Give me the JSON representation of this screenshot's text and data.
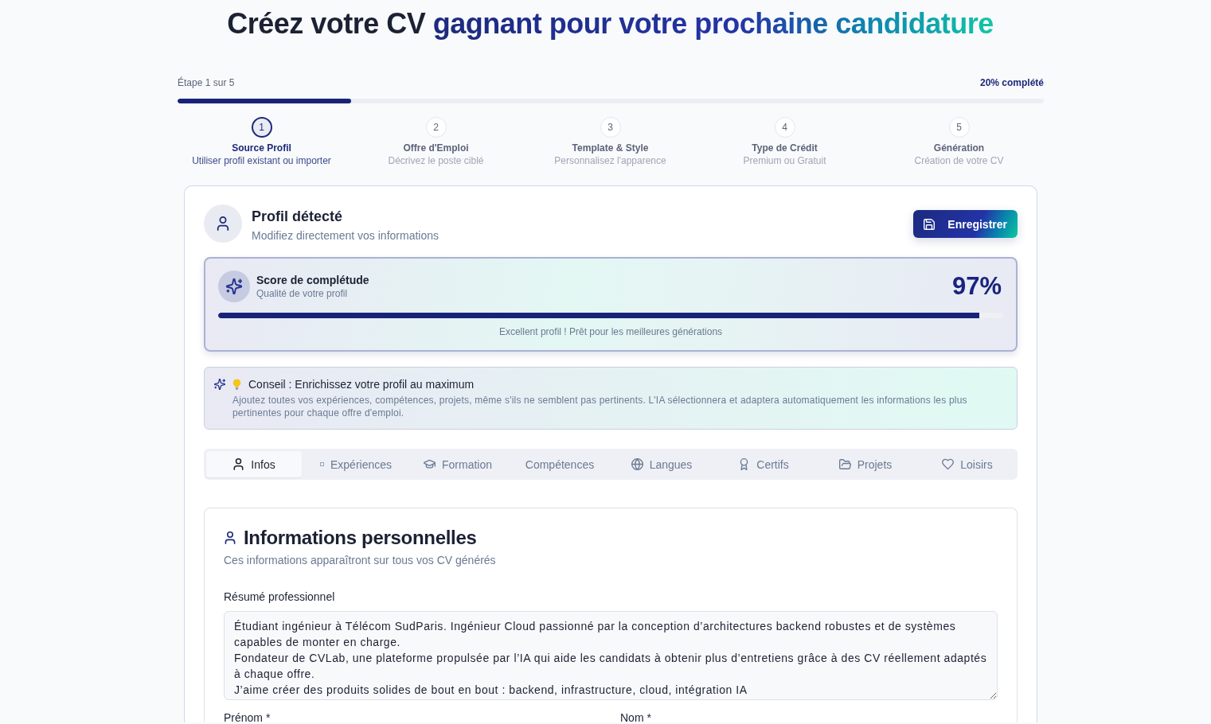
{
  "title": {
    "lead": "Créez votre CV",
    "highlight": "gagnant pour votre prochaine candidature"
  },
  "progress": {
    "step_label": "Étape 1 sur 5",
    "percent_label": "20% complété",
    "level": 0.2
  },
  "steps": [
    {
      "number": "1",
      "title": "Source Profil",
      "subtitle": "Utiliser profil existant ou importer",
      "selected": true
    },
    {
      "number": "2",
      "title": "Offre d'Emploi",
      "subtitle": "Décrivez le poste ciblé",
      "selected": false
    },
    {
      "number": "3",
      "title": "Template & Style",
      "subtitle": "Personnalisez l'apparence",
      "selected": false
    },
    {
      "number": "4",
      "title": "Type de Crédit",
      "subtitle": "Premium ou Gratuit",
      "selected": false
    },
    {
      "number": "5",
      "title": "Génération",
      "subtitle": "Création de votre CV",
      "selected": false
    }
  ],
  "profile": {
    "title": "Profil détecté",
    "subtitle": "Modifiez directement vos informations",
    "save_button": "Enregistrer"
  },
  "score": {
    "title": "Score de complétude",
    "subtitle": "Qualité de votre profil",
    "value": "97%",
    "level": 0.97,
    "caption": "Excellent profil ! Prêt pour les meilleures générations"
  },
  "tip": {
    "title": "Conseil : Enrichissez votre profil au maximum",
    "body": "Ajoutez toutes vos expériences, compétences, projets, même s'ils ne semblent pas pertinents. L'IA sélectionnera et adaptera automatiquement les informations les plus pertinentes pour chaque offre d'emploi."
  },
  "tabs": [
    {
      "label": "Infos",
      "selected": true
    },
    {
      "label": "Expériences",
      "selected": false
    },
    {
      "label": "Formation",
      "selected": false
    },
    {
      "label": "Compétences",
      "selected": false
    },
    {
      "label": "Langues",
      "selected": false
    },
    {
      "label": "Certifs",
      "selected": false
    },
    {
      "label": "Projets",
      "selected": false
    },
    {
      "label": "Loisirs",
      "selected": false
    }
  ],
  "personal_info": {
    "title": "Informations personnelles",
    "subtitle": "Ces informations apparaîtront sur tous vos CV générés",
    "summary": {
      "label": "Résumé professionnel",
      "value": "Étudiant ingénieur à Télécom SudParis. Ingénieur Cloud passionné par la conception d’architectures backend robustes et de systèmes capables de monter en charge.\nFondateur de CVLab, une plateforme propulsée par l’IA qui aide les candidats à obtenir plus d’entretiens grâce à des CV réellement adaptés à chaque offre.\nJ’aime créer des produits solides de bout en bout : backend, infrastructure, cloud, intégration IA"
    },
    "fields": [
      {
        "label": "Prénom *"
      },
      {
        "label": "Nom *"
      }
    ]
  }
}
